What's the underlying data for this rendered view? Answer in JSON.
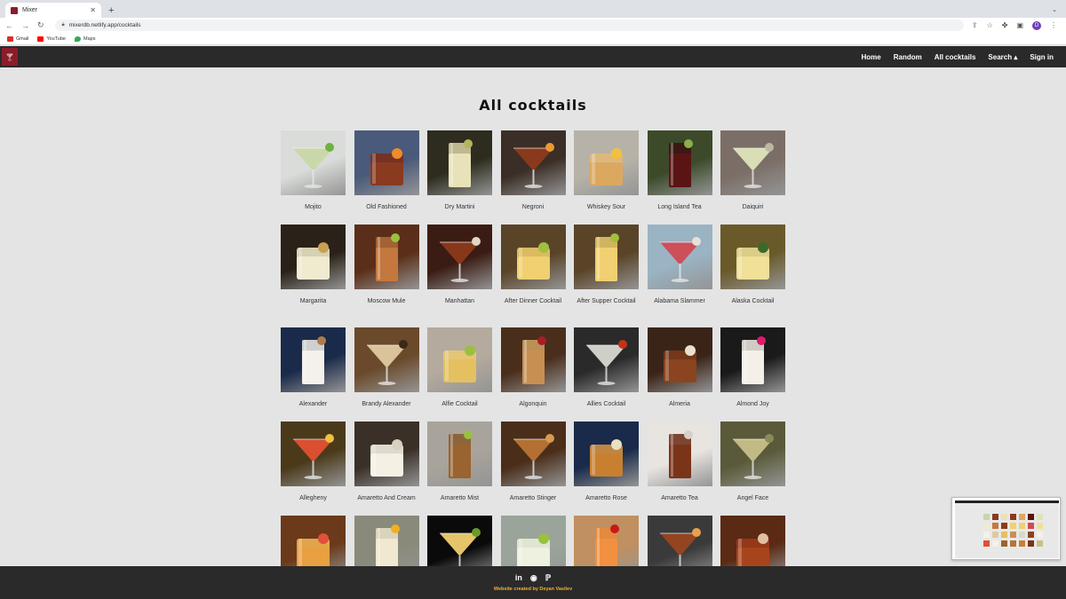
{
  "browser": {
    "tab_title": "Mixer",
    "tab_close": "✕",
    "new_tab": "+",
    "url": "mixerdb.netlify.app/cocktails",
    "profile_initial": "D",
    "bookmarks": [
      {
        "label": "Gmail",
        "color": "#d93025"
      },
      {
        "label": "YouTube",
        "color": "#ff0000"
      },
      {
        "label": "Maps",
        "color": "#34a853"
      }
    ]
  },
  "site": {
    "menu": [
      "Home",
      "Random",
      "All cocktails",
      "Search ▴",
      "Sign in"
    ],
    "title": "All cocktails"
  },
  "cocktails": [
    {
      "name": "Mojito",
      "bg": "#d9dcd8",
      "glass": "#e8ece4",
      "liquid": "#c9d6a6",
      "accent": "#6cb33f"
    },
    {
      "name": "Old Fashioned",
      "bg": "#4a5a7a",
      "glass": "#7a2e1c",
      "liquid": "#8a3a1e",
      "accent": "#f08a2a"
    },
    {
      "name": "Dry Martini",
      "bg": "#2e2c1e",
      "glass": "#d8d0a4",
      "liquid": "#e8e2b8",
      "accent": "#b3b460"
    },
    {
      "name": "Negroni",
      "bg": "#3a2e26",
      "glass": "#6a2a18",
      "liquid": "#8e3a1c",
      "accent": "#e89a30"
    },
    {
      "name": "Whiskey Sour",
      "bg": "#b6b2a8",
      "glass": "#e0b878",
      "liquid": "#dca860",
      "accent": "#f2c040"
    },
    {
      "name": "Long Island Tea",
      "bg": "#3c4a2a",
      "glass": "#3a1010",
      "liquid": "#5a1414",
      "accent": "#8ab04a"
    },
    {
      "name": "Daiquiri",
      "bg": "#7a6e66",
      "glass": "#e8eccc",
      "liquid": "#dee4ba",
      "accent": "#bcb8a4"
    },
    {
      "name": "Margarita",
      "bg": "#2a2218",
      "glass": "#e8e4c4",
      "liquid": "#f0ead0",
      "accent": "#c8a050"
    },
    {
      "name": "Moscow Mule",
      "bg": "#5a2e18",
      "glass": "#b06a3a",
      "liquid": "#c4783e",
      "accent": "#9ac040"
    },
    {
      "name": "Manhattan",
      "bg": "#3a1c14",
      "glass": "#7a3018",
      "liquid": "#8c3a1a",
      "accent": "#e0d8c8"
    },
    {
      "name": "After Dinner Cocktail",
      "bg": "#5a4428",
      "glass": "#e8c868",
      "liquid": "#f0d070",
      "accent": "#a0c040"
    },
    {
      "name": "After Supper Cocktail",
      "bg": "#5a4428",
      "glass": "#e8c868",
      "liquid": "#f0d070",
      "accent": "#a0c040"
    },
    {
      "name": "Alabama Slammer",
      "bg": "#9ab4c4",
      "glass": "#c8404a",
      "liquid": "#d04a54",
      "accent": "#e8e0d8"
    },
    {
      "name": "Alaska Cocktail",
      "bg": "#6a5a2a",
      "glass": "#e8d890",
      "liquid": "#f0e098",
      "accent": "#3a6a2a"
    },
    {
      "name": "Alexander",
      "bg": "#1a2a4a",
      "glass": "#f0ece8",
      "liquid": "#f4f0ea",
      "accent": "#b07a4a"
    },
    {
      "name": "Brandy Alexander",
      "bg": "#6a4a2a",
      "glass": "#e8d4b0",
      "liquid": "#e0c8a0",
      "accent": "#3a2a1a"
    },
    {
      "name": "Alfie Cocktail",
      "bg": "#b4aa9e",
      "glass": "#e8c870",
      "liquid": "#e4c060",
      "accent": "#9ac040"
    },
    {
      "name": "Algonquin",
      "bg": "#4a2e1c",
      "glass": "#d0a060",
      "liquid": "#c89050",
      "accent": "#a81c28"
    },
    {
      "name": "Allies Cocktail",
      "bg": "#2a2a2a",
      "glass": "#c8c8c8",
      "liquid": "#d8d8d0",
      "accent": "#c83018"
    },
    {
      "name": "Almeria",
      "bg": "#3a2418",
      "glass": "#7a3a1a",
      "liquid": "#8a4420",
      "accent": "#e8e0d0"
    },
    {
      "name": "Almond Joy",
      "bg": "#1a1a1a",
      "glass": "#f0ece4",
      "liquid": "#f4f0e8",
      "accent": "#e01a6a"
    },
    {
      "name": "Allegheny",
      "bg": "#4a3a1a",
      "glass": "#e8603a",
      "liquid": "#e05030",
      "accent": "#f0c040"
    },
    {
      "name": "Amaretto And Cream",
      "bg": "#3a3028",
      "glass": "#f0ece0",
      "liquid": "#f4f0e4",
      "accent": "#d8d0c0"
    },
    {
      "name": "Amaretto Mist",
      "bg": "#a8a49c",
      "glass": "#8a5a2a",
      "liquid": "#9a6430",
      "accent": "#9ac040"
    },
    {
      "name": "Amaretto Stinger",
      "bg": "#4a2e1a",
      "glass": "#c08040",
      "liquid": "#b87434",
      "accent": "#d89a50"
    },
    {
      "name": "Amaretto Rose",
      "bg": "#1a2a4a",
      "glass": "#d09040",
      "liquid": "#c88030",
      "accent": "#e8e0c0"
    },
    {
      "name": "Amaretto Tea",
      "bg": "#e8e4e0",
      "glass": "#6a2a14",
      "liquid": "#7a3418",
      "accent": "#d8d0c8"
    },
    {
      "name": "Angel Face",
      "bg": "#5a5a3a",
      "glass": "#d8d0a0",
      "liquid": "#c8c088",
      "accent": "#8a8a5a"
    },
    {
      "name": "",
      "bg": "#6a3a1a",
      "glass": "#f0b050",
      "liquid": "#e8a040",
      "accent": "#e0503a"
    },
    {
      "name": "",
      "bg": "#8a8a7a",
      "glass": "#e8e0c8",
      "liquid": "#f0e8d0",
      "accent": "#f0b020"
    },
    {
      "name": "",
      "bg": "#0a0a0a",
      "glass": "#e8c860",
      "liquid": "#f0d070",
      "accent": "#6a9a2a"
    },
    {
      "name": "",
      "bg": "#9aa49a",
      "glass": "#e8ecd8",
      "liquid": "#eef0e0",
      "accent": "#9ac040"
    },
    {
      "name": "",
      "bg": "#c09060",
      "glass": "#e88a3a",
      "liquid": "#f09040",
      "accent": "#c8181a"
    },
    {
      "name": "",
      "bg": "#3a3a3a",
      "glass": "#8a3a1a",
      "liquid": "#9a4420",
      "accent": "#e8a050"
    },
    {
      "name": "",
      "bg": "#5a2a14",
      "glass": "#9a3a18",
      "liquid": "#a8441c",
      "accent": "#e0c0a0"
    }
  ],
  "footer": {
    "social": [
      "in",
      "◉",
      "ℙ"
    ],
    "credit": "Website created by Deyan Vasilev"
  }
}
